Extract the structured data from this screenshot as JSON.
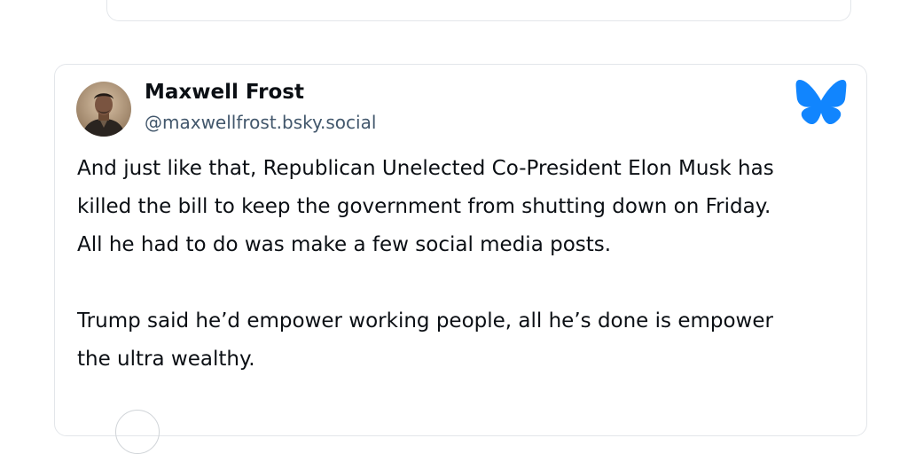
{
  "post": {
    "author_name": "Maxwell Frost",
    "author_handle": "@maxwellfrost.bsky.social",
    "paragraphs": {
      "p1_line1": "And just like that, Republican Unelected Co-President Elon Musk has",
      "p1_line2": "killed the bill to keep the government from shutting down on Friday.",
      "p1_line3": "All he had to do was make a few social media posts.",
      "p2_line1": "Trump said he’d empower working people, all he’s done is empower",
      "p2_line2": "the ultra wealthy."
    }
  },
  "colors": {
    "brand_blue": "#1185fe",
    "handle_gray": "#42576c",
    "border": "#e3e6ea"
  },
  "icons": {
    "logo": "bluesky-butterfly-icon"
  }
}
